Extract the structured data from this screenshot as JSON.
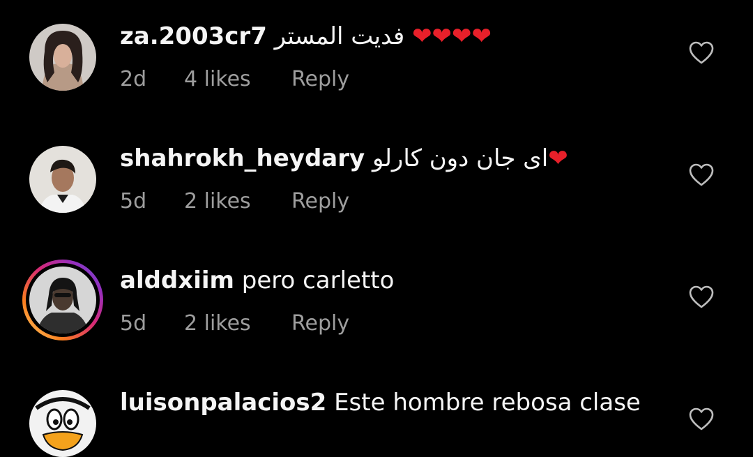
{
  "comments": [
    {
      "username": "za.2003cr7",
      "text": "فدیت المستر",
      "hearts": "❤❤❤❤",
      "age": "2d",
      "likes": "4 likes",
      "reply": "Reply"
    },
    {
      "username": "shahrokh_heydary",
      "text": "ای جان دون کارلو",
      "hearts": "❤",
      "age": "5d",
      "likes": "2 likes",
      "reply": "Reply"
    },
    {
      "username": "alddxiim",
      "text": "pero carletto",
      "age": "5d",
      "likes": "2 likes",
      "reply": "Reply"
    },
    {
      "username": "luisonpalacios2",
      "text": "Este hombre rebosa clase"
    }
  ],
  "icons": {
    "like": "heart-outline-icon",
    "story_ring": "story-ring"
  },
  "colors": {
    "background": "#000000",
    "text": "#f5f5f5",
    "secondary": "#9e9e9e",
    "heart": "#e8202a"
  }
}
